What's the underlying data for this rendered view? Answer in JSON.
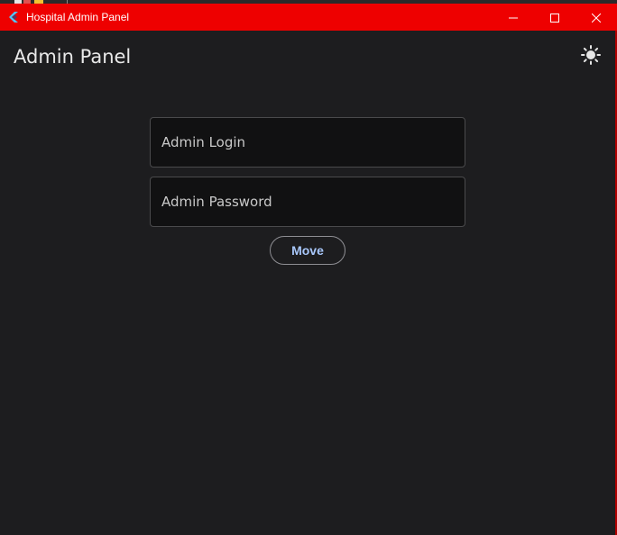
{
  "window": {
    "title": "Hospital Admin Panel",
    "titlebar_color": "#ee0000",
    "icons": {
      "app": "flutter-logo-icon",
      "minimize": "minimize-icon",
      "maximize": "maximize-icon",
      "close": "close-icon"
    }
  },
  "header": {
    "title": "Admin Panel",
    "theme_icon": "sun-icon"
  },
  "form": {
    "login_placeholder": "Admin Login",
    "login_value": "",
    "password_placeholder": "Admin Password",
    "password_value": "",
    "submit_label": "Move"
  },
  "colors": {
    "background": "#1d1d1f",
    "field_background": "#111112",
    "button_text": "#a8c7fa"
  }
}
